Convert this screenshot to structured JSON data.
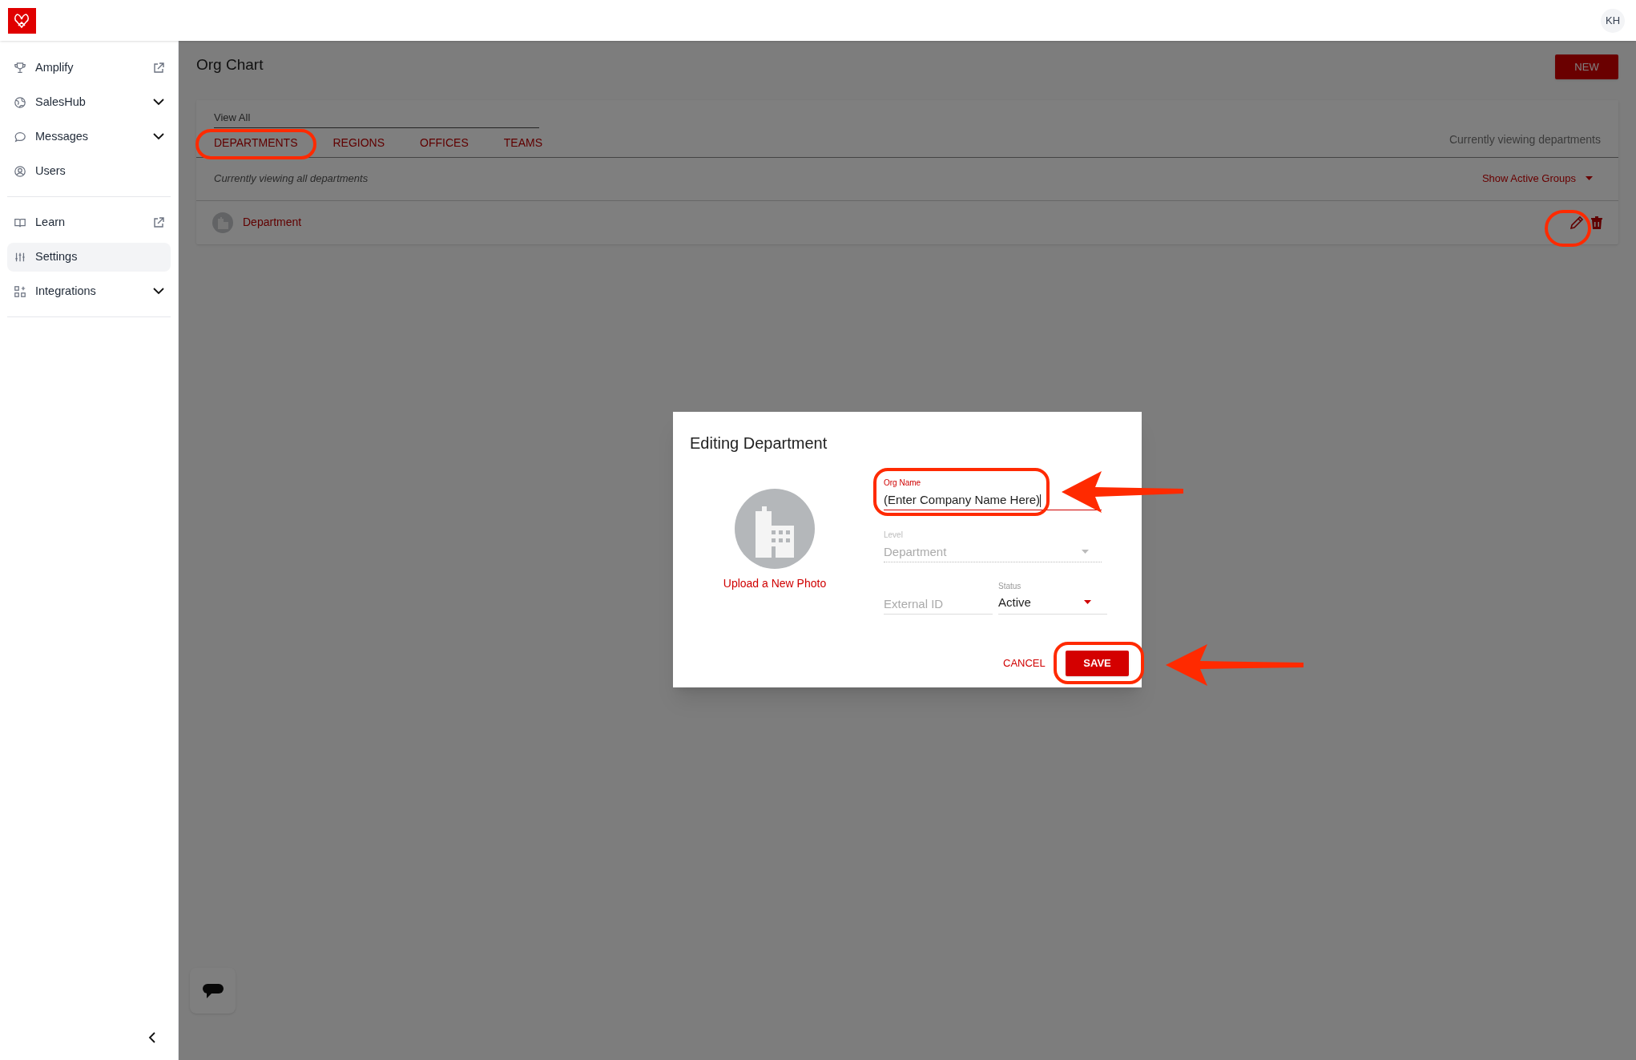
{
  "top_bar": {
    "avatar": "KH"
  },
  "sidebar": {
    "groups": [
      [
        {
          "label": "Amplify",
          "kind": "external",
          "selected": false
        },
        {
          "label": "SalesHub",
          "kind": "expand",
          "selected": false
        },
        {
          "label": "Messages",
          "kind": "expand",
          "selected": false
        },
        {
          "label": "Users",
          "kind": "plain",
          "selected": false
        }
      ],
      [
        {
          "label": "Learn",
          "kind": "external",
          "selected": false
        },
        {
          "label": "Settings",
          "kind": "plain",
          "selected": true
        },
        {
          "label": "Integrations",
          "kind": "expand",
          "selected": false
        }
      ]
    ]
  },
  "page": {
    "title": "Org Chart",
    "new_button": "NEW"
  },
  "card": {
    "view_all": "View All",
    "tabs": [
      "DEPARTMENTS",
      "REGIONS",
      "OFFICES",
      "TEAMS"
    ],
    "tabs_caption": "Currently viewing departments",
    "filter_caption": "Currently viewing all departments",
    "filter_dropdown": "Show Active Groups",
    "rows": [
      {
        "name": "Department"
      }
    ]
  },
  "dialog": {
    "title": "Editing Department",
    "upload_link": "Upload a New Photo",
    "org_name": {
      "label": "Org Name",
      "value": "(Enter Company Name Here)",
      "focused": true
    },
    "level": {
      "label": "Level",
      "value": "Department",
      "disabled": true
    },
    "external_id": {
      "placeholder": "External ID"
    },
    "status": {
      "label": "Status",
      "value": "Active"
    },
    "buttons": {
      "cancel": "CANCEL",
      "save": "SAVE"
    }
  }
}
